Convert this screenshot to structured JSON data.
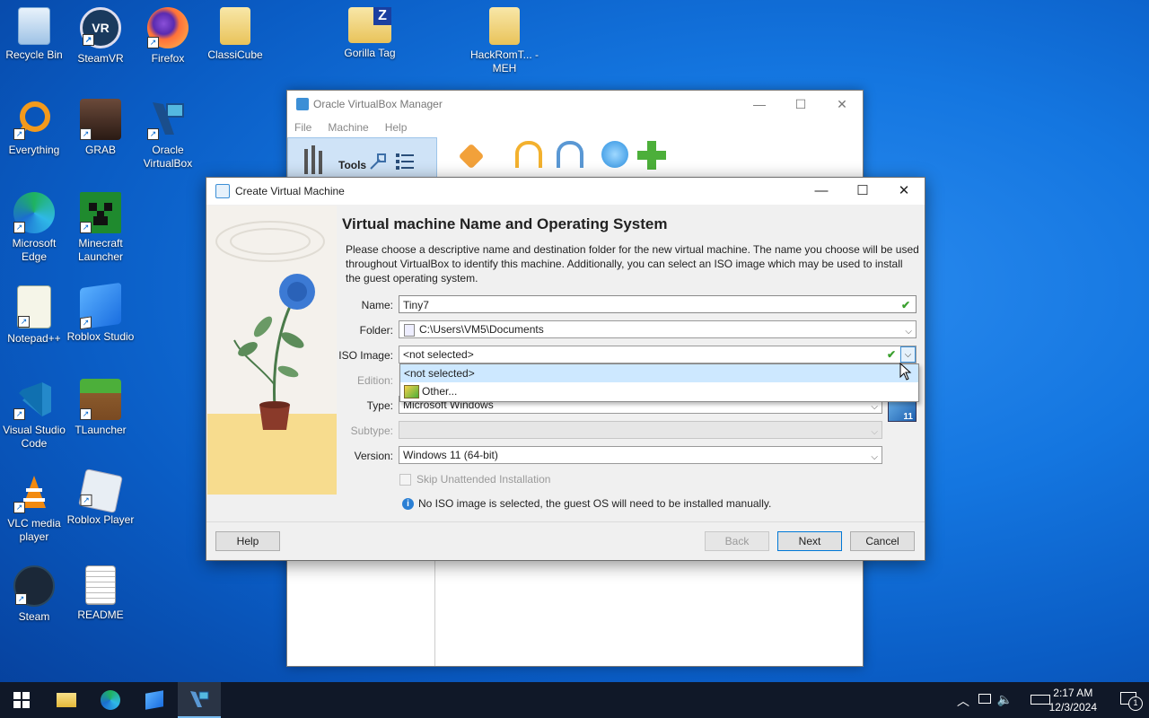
{
  "desktop": {
    "icons": [
      {
        "label": "Recycle Bin"
      },
      {
        "label": "SteamVR"
      },
      {
        "label": "Firefox"
      },
      {
        "label": "ClassiCube"
      },
      {
        "label": "Gorilla Tag"
      },
      {
        "label": "HackRomT... - MEH"
      },
      {
        "label": "Everything"
      },
      {
        "label": "GRAB"
      },
      {
        "label": "Oracle VirtualBox"
      },
      {
        "label": "Microsoft Edge"
      },
      {
        "label": "Minecraft Launcher"
      },
      {
        "label": "Notepad++"
      },
      {
        "label": "Roblox Studio"
      },
      {
        "label": "Visual Studio Code"
      },
      {
        "label": "TLauncher"
      },
      {
        "label": "VLC media player"
      },
      {
        "label": "Roblox Player"
      },
      {
        "label": "Steam"
      },
      {
        "label": "README"
      }
    ]
  },
  "vbox_manager": {
    "title": "Oracle VirtualBox Manager",
    "menu": [
      "File",
      "Machine",
      "Help"
    ],
    "tools_label": "Tools"
  },
  "dialog": {
    "title": "Create Virtual Machine",
    "heading": "Virtual machine Name and Operating System",
    "description": "Please choose a descriptive name and destination folder for the new virtual machine. The name you choose will be used throughout VirtualBox to identify this machine. Additionally, you can select an ISO image which may be used to install the guest operating system.",
    "labels": {
      "name": "Name:",
      "folder": "Folder:",
      "iso": "ISO Image:",
      "edition": "Edition:",
      "type": "Type:",
      "subtype": "Subtype:",
      "version": "Version:"
    },
    "values": {
      "name": "Tiny7",
      "folder": "C:\\Users\\VM5\\Documents",
      "iso": "<not selected>",
      "type": "Microsoft Windows",
      "subtype": "",
      "version": "Windows 11 (64-bit)"
    },
    "iso_options": [
      "<not selected>",
      "Other..."
    ],
    "skip_unattended": "Skip Unattended Installation",
    "info": "No ISO image is selected, the guest OS will need to be installed manually.",
    "buttons": {
      "help": "Help",
      "back": "Back",
      "next": "Next",
      "cancel": "Cancel"
    }
  },
  "taskbar": {
    "time": "2:17 AM",
    "date": "12/3/2024",
    "notification_count": "1"
  }
}
